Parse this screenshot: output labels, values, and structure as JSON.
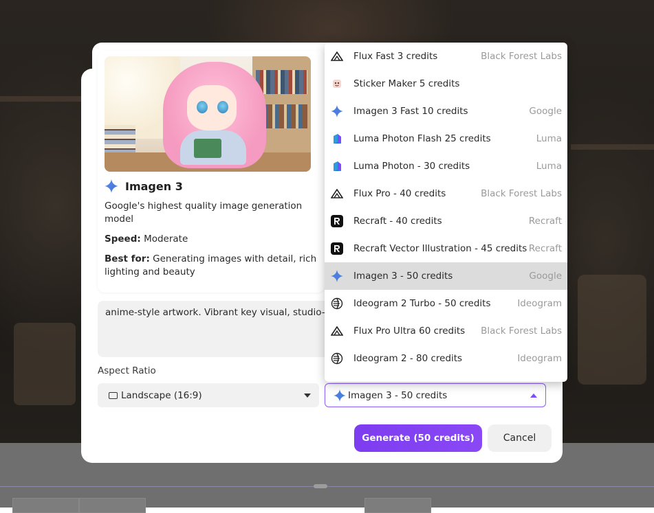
{
  "info": {
    "title": "Imagen 3",
    "description": "Google's highest quality image generation model",
    "speed_label": "Speed:",
    "speed_value": "Moderate",
    "bestfor_label": "Best for:",
    "bestfor_value": "Generating images with detail, rich lighting and beauty"
  },
  "prompt": {
    "value": "anime-style artwork. Vibrant key visual, studio-qu"
  },
  "aspect": {
    "label": "Aspect Ratio",
    "selected": "Landscape (16:9)"
  },
  "model_select": {
    "selected": "Imagen 3 - 50 credits"
  },
  "buttons": {
    "generate": "Generate (50 credits)",
    "cancel": "Cancel"
  },
  "dropdown": {
    "items": [
      {
        "label": "Flux Fast 3 credits",
        "provider": "Black Forest Labs",
        "icon": "bfl"
      },
      {
        "label": "Sticker Maker 5 credits",
        "provider": "",
        "icon": "sticker"
      },
      {
        "label": "Imagen 3 Fast 10 credits",
        "provider": "Google",
        "icon": "gemini"
      },
      {
        "label": "Luma Photon Flash 25 credits",
        "provider": "Luma",
        "icon": "luma"
      },
      {
        "label": "Luma Photon - 30 credits",
        "provider": "Luma",
        "icon": "luma"
      },
      {
        "label": "Flux Pro - 40 credits",
        "provider": "Black Forest Labs",
        "icon": "bfl"
      },
      {
        "label": "Recraft - 40 credits",
        "provider": "Recraft",
        "icon": "recraft"
      },
      {
        "label": "Recraft Vector Illustration - 45 credits",
        "provider": "Recraft",
        "icon": "recraft"
      },
      {
        "label": "Imagen 3 - 50 credits",
        "provider": "Google",
        "icon": "gemini",
        "selected": true
      },
      {
        "label": "Ideogram 2 Turbo - 50 credits",
        "provider": "Ideogram",
        "icon": "ideogram"
      },
      {
        "label": "Flux Pro Ultra 60 credits",
        "provider": "Black Forest Labs",
        "icon": "bfl"
      },
      {
        "label": "Ideogram 2 - 80 credits",
        "provider": "Ideogram",
        "icon": "ideogram"
      }
    ]
  },
  "colors": {
    "accent": "#7c3aed",
    "selected_row": "#dcdcdc",
    "gemini_blue": "#4a7fe0"
  }
}
